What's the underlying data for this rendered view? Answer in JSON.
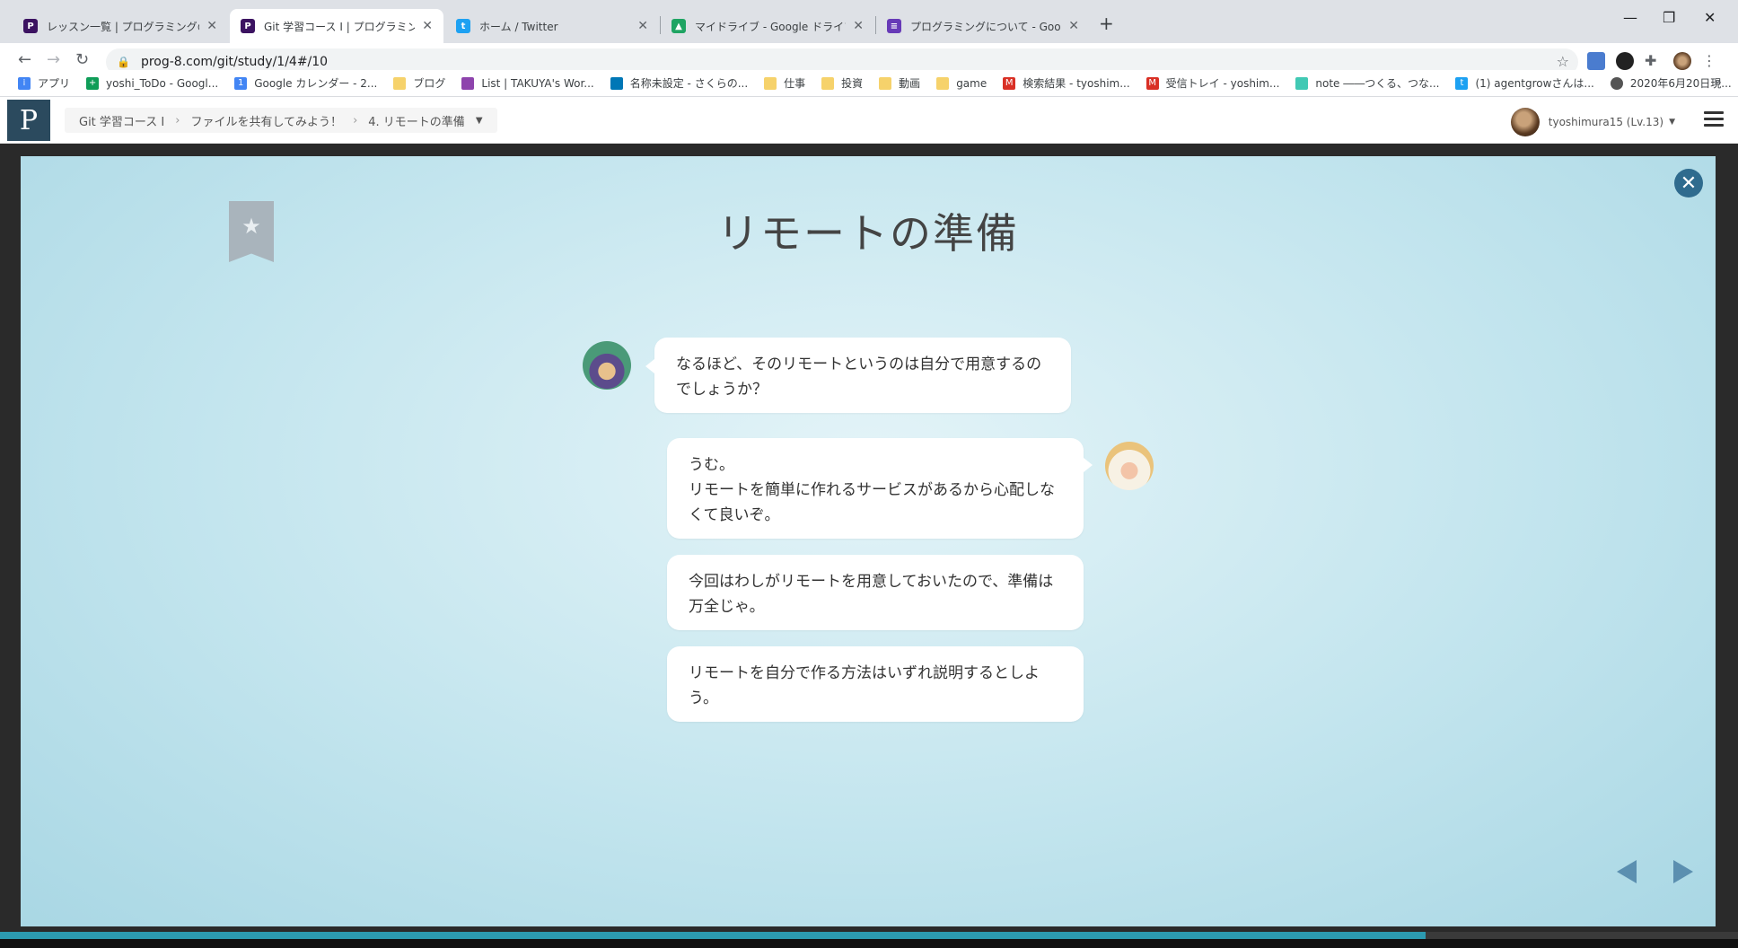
{
  "browser": {
    "tabs": [
      {
        "title": "レッスン一覧 | プログラミングの入門な",
        "color": "#3c1361",
        "glyph": "P"
      },
      {
        "title": "Git 学習コース I | プログラミングの入門",
        "color": "#3c1361",
        "glyph": "P"
      },
      {
        "title": "ホーム / Twitter",
        "color": "#1da1f2",
        "glyph": "t"
      },
      {
        "title": "マイドライブ - Google ドライブ",
        "color": "#1fa463",
        "glyph": "▲"
      },
      {
        "title": "プログラミングについて - Google フォー",
        "color": "#673ab7",
        "glyph": "≡"
      }
    ],
    "url": "prog-8.com/git/study/1/4#/10"
  },
  "bookmarks": [
    {
      "label": "アプリ",
      "type": "apps"
    },
    {
      "label": "yoshi_ToDo - Googl...",
      "type": "sheet",
      "color": "#0f9d58"
    },
    {
      "label": "Google カレンダー - 2...",
      "type": "calendar",
      "color": "#4285f4"
    },
    {
      "label": "ブログ",
      "type": "folder"
    },
    {
      "label": "List | TAKUYA's Wor...",
      "type": "site",
      "color": "#8e44ad"
    },
    {
      "label": "名称未設定 - さくらの...",
      "type": "site",
      "color": "#0077b6"
    },
    {
      "label": "仕事",
      "type": "folder"
    },
    {
      "label": "投資",
      "type": "folder"
    },
    {
      "label": "動画",
      "type": "folder"
    },
    {
      "label": "game",
      "type": "folder"
    },
    {
      "label": "検索結果 - tyoshim...",
      "type": "gmail",
      "color": "#d93025"
    },
    {
      "label": "受信トレイ - yoshim...",
      "type": "gmail",
      "color": "#d93025"
    },
    {
      "label": "note ――つくる、つな...",
      "type": "site",
      "color": "#41c9b4"
    },
    {
      "label": "(1) agentgrowさんは...",
      "type": "twitter",
      "color": "#1da1f2"
    },
    {
      "label": "2020年6月20日現...",
      "type": "site",
      "color": "#555555"
    }
  ],
  "site": {
    "breadcrumb": [
      "Git 学習コース I",
      "ファイルを共有してみよう！",
      "4. リモートの準備"
    ],
    "user": "tyoshimura15 (Lv.13)"
  },
  "lesson": {
    "title": "リモートの準備",
    "messages": [
      {
        "speaker": "ninja",
        "text": "なるほど、そのリモートというのは自分で用意するのでしょうか？"
      },
      {
        "speaker": "sheep",
        "text": "うむ。\nリモートを簡単に作れるサービスがあるから心配しなくて良いぞ。"
      },
      {
        "speaker": "sheep",
        "text": "今回はわしがリモートを用意しておいたので、準備は万全じゃ。"
      },
      {
        "speaker": "sheep",
        "text": "リモートを自分で作る方法はいずれ説明するとしよう。"
      }
    ],
    "progress_fraction": 0.82
  },
  "icons": {
    "bookmark": "bookmark-star-icon",
    "close": "close-icon",
    "prev": "prev-arrow-icon",
    "next": "next-arrow-icon"
  }
}
